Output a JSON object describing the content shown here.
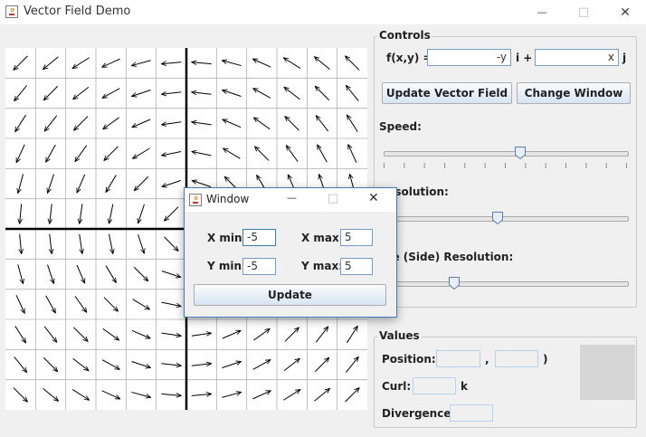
{
  "window": {
    "title": "Vector Field Demo",
    "minimize_glyph": "—",
    "maximize_glyph": "□",
    "close_glyph": "✕"
  },
  "controls": {
    "legend": "Controls",
    "fxy_label": "f(x,y) =",
    "i_value": "-y",
    "i_label": "i +",
    "j_value": "x",
    "j_label": "j",
    "update_vector_field": "Update Vector Field",
    "change_window": "Change Window",
    "speed_label": "Speed:",
    "speed_level": 0.56,
    "arrow_resolution_label": "Resolution:",
    "arrow_resolution_level": 0.47,
    "figure_resolution_label": "ure (Side) Resolution:",
    "figure_resolution_level": 0.29
  },
  "values": {
    "legend": "Values",
    "position_label": "Position: (",
    "comma": ",",
    "close_paren": ")",
    "position_x": "",
    "position_y": "",
    "curl_label": "Curl:",
    "curl_value": "",
    "curl_unit": "k",
    "divergence_label": "Divergence:",
    "divergence_value": ""
  },
  "dialog": {
    "title": "Window",
    "minimize_glyph": "—",
    "maximize_glyph": "□",
    "close_glyph": "✕",
    "xmin_label": "X min:",
    "xmin_value": "-5",
    "xmax_label": "X max:",
    "xmax_value": "5",
    "ymin_label": "Y min:",
    "ymin_value": "-5",
    "ymax_label": "Y max:",
    "ymax_value": "5",
    "update_label": "Update"
  },
  "plot": {
    "x_range": [
      -5,
      5
    ],
    "y_range": [
      -5,
      5
    ],
    "grid_divisions": 12
  },
  "icons": {
    "app": "java-cup-icon"
  },
  "colors": {
    "accent": "#3e7ab8",
    "button_top": "#fafcfe",
    "button_bottom": "#d7e4f2"
  }
}
